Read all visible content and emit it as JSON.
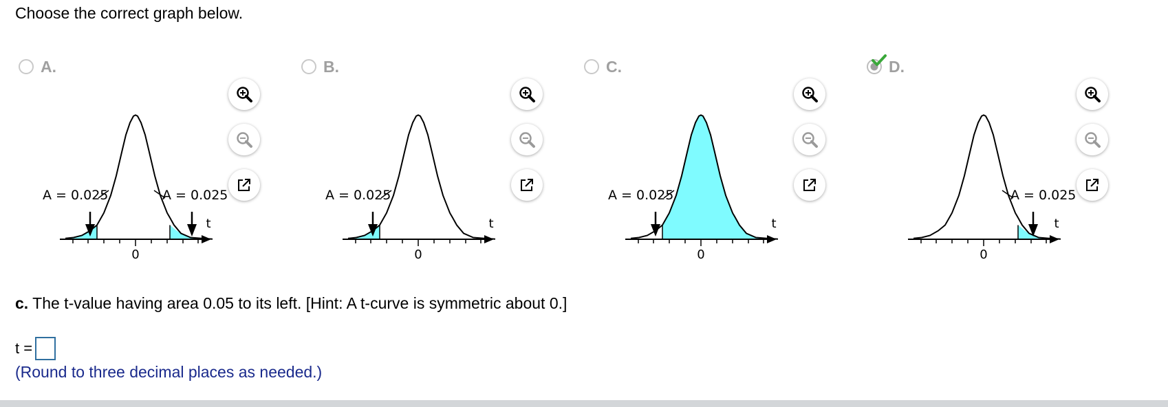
{
  "prompt": "Choose the correct graph below.",
  "options": [
    {
      "letter": "A.",
      "selected": false,
      "labels": [
        "A = 0.025",
        "A = 0.025"
      ],
      "shading": "both-tails"
    },
    {
      "letter": "B.",
      "selected": false,
      "labels": [
        "A = 0.025"
      ],
      "shading": "left-tail"
    },
    {
      "letter": "C.",
      "selected": false,
      "labels": [
        "A = 0.025"
      ],
      "shading": "right-of-left-cutoff"
    },
    {
      "letter": "D.",
      "selected": true,
      "labels": [
        "A = 0.025"
      ],
      "shading": "right-tail"
    }
  ],
  "axis": {
    "zero_label": "0",
    "var_label": "t"
  },
  "question_c": {
    "prefix": "c.",
    "text": " The t-value having area 0.05 to its left. [Hint: A t-curve is symmetric about 0.]"
  },
  "answer": {
    "label": "t =",
    "value": ""
  },
  "hint_note": "(Round to three decimal places as needed.)",
  "icons": [
    "zoom-in-icon",
    "zoom-out-icon",
    "open-external-icon",
    "checkmark-icon"
  ],
  "colors": {
    "shade": "#7ffbff",
    "check": "#3aa83a",
    "hint_text": "#1a2a8c",
    "input_border": "#2f6f9f"
  }
}
